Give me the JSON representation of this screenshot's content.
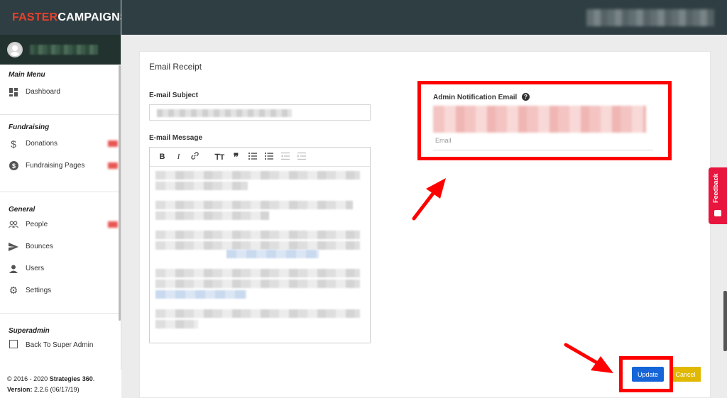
{
  "brand": {
    "part1": "FASTER",
    "part2": "CAMPAIGNS"
  },
  "sidebar": {
    "sections": [
      {
        "title": "Main Menu",
        "items": [
          {
            "label": "Dashboard",
            "icon": "dashboard-icon"
          }
        ]
      },
      {
        "title": "Fundraising",
        "items": [
          {
            "label": "Donations",
            "icon": "dollar-icon"
          },
          {
            "label": "Fundraising Pages",
            "icon": "dollar-circle-icon"
          }
        ]
      },
      {
        "title": "General",
        "items": [
          {
            "label": "People",
            "icon": "people-icon"
          },
          {
            "label": "Bounces",
            "icon": "send-icon"
          },
          {
            "label": "Users",
            "icon": "user-icon"
          },
          {
            "label": "Settings",
            "icon": "gear-icon"
          }
        ]
      },
      {
        "title": "Superadmin",
        "items": [
          {
            "label": "Back To Super Admin",
            "icon": "back-icon"
          }
        ]
      }
    ]
  },
  "footer": {
    "copyright": "© 2016 - 2020 ",
    "company": "Strategies 360",
    "period": ".",
    "version_label": "Version:",
    "version": " 2.2.6 (06/17/19)"
  },
  "form": {
    "title": "Email Receipt",
    "subject_label": "E-mail Subject",
    "message_label": "E-mail Message",
    "admin_label": "Admin Notification Email",
    "admin_placeholder": "Email",
    "toolbar": [
      "B",
      "I",
      "link",
      "T",
      "quote",
      "ul",
      "ol",
      "outdent",
      "indent"
    ],
    "update_label": "Update",
    "cancel_label": "Cancel"
  },
  "feedback": {
    "label": "Feedback"
  },
  "colors": {
    "topbar": "#2f3e42",
    "brand_red": "#e8412c",
    "update": "#1565d8",
    "cancel": "#e0b800",
    "annotation": "#ff0000",
    "feedback": "#e8163e"
  }
}
